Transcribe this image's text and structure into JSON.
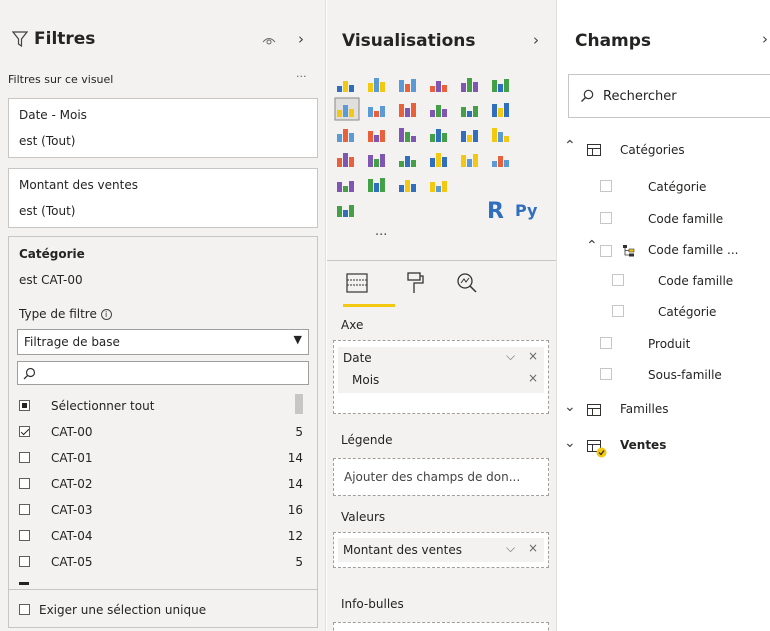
{
  "filters": {
    "title": "Filtres",
    "section_label": "Filtres sur ce visuel",
    "more": "···",
    "cards": [
      {
        "name": "Date - Mois",
        "state": "est (Tout)"
      },
      {
        "name": "Montant des ventes",
        "state": "est (Tout)"
      }
    ],
    "active_card": {
      "name": "Catégorie",
      "state": "est CAT-00",
      "filter_type_label": "Type de filtre",
      "filter_type_value": "Filtrage de base",
      "select_all": "Sélectionner tout",
      "items": [
        {
          "label": "CAT-00",
          "count": "5",
          "checked": true
        },
        {
          "label": "CAT-01",
          "count": "14",
          "checked": false
        },
        {
          "label": "CAT-02",
          "count": "14",
          "checked": false
        },
        {
          "label": "CAT-03",
          "count": "16",
          "checked": false
        },
        {
          "label": "CAT-04",
          "count": "12",
          "checked": false
        },
        {
          "label": "CAT-05",
          "count": "5",
          "checked": false
        }
      ],
      "single_select": "Exiger une sélection unique"
    }
  },
  "viz": {
    "title": "Visualisations",
    "more": "···",
    "r_label": "R",
    "py_label": "Py",
    "wells": {
      "axis": "Axe",
      "axis_fields": [
        "Date",
        "Mois"
      ],
      "legend": "Légende",
      "legend_placeholder": "Ajouter des champs de don...",
      "values": "Valeurs",
      "values_field": "Montant des ventes",
      "tooltips": "Info-bulles"
    }
  },
  "fields": {
    "title": "Champs",
    "search_placeholder": "Rechercher",
    "tables": {
      "categories": "Catégories",
      "cat_fields": [
        "Catégorie",
        "Code famille"
      ],
      "hierarchy": "Code famille ...",
      "hierarchy_fields": [
        "Code famille",
        "Catégorie"
      ],
      "cat_fields2": [
        "Produit",
        "Sous-famille"
      ],
      "familles": "Familles",
      "ventes": "Ventes"
    }
  },
  "colors": {
    "accent": "#f2c811",
    "pane_bg": "#f3f2f1",
    "border": "#c8c6c4"
  }
}
